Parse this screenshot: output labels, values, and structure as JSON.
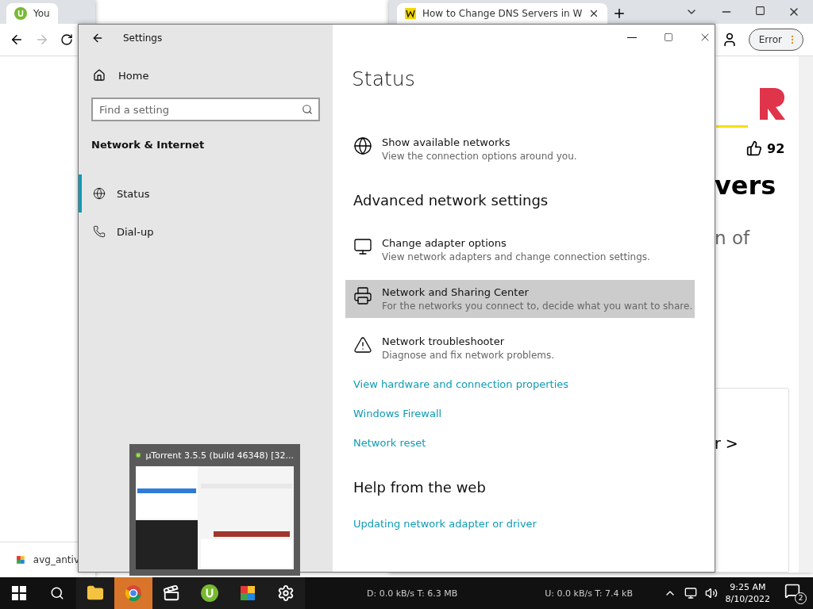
{
  "back_browser": {
    "tab_title": "You",
    "download": "avg_antiv"
  },
  "front_browser": {
    "tab_title": "How to Change DNS Servers in W",
    "profile_button": "Error",
    "likes": "92",
    "heading_fragment": "vers",
    "text_fragment": "n of",
    "link_fragment": "r >"
  },
  "settings": {
    "title": "Settings",
    "home": "Home",
    "search": {
      "placeholder": "Find a setting"
    },
    "section": "Network & Internet",
    "nav": [
      {
        "label": "Status",
        "selected": true
      },
      {
        "label": "Dial-up",
        "selected": false
      }
    ],
    "page_title": "Status",
    "content": [
      {
        "kind": "option",
        "title": "Show available networks",
        "description": "View the connection options around you.",
        "highlighted": false
      },
      {
        "kind": "heading",
        "title": "Advanced network settings"
      },
      {
        "kind": "option",
        "title": "Change adapter options",
        "description": "View network adapters and change connection settings.",
        "highlighted": false
      },
      {
        "kind": "option",
        "title": "Network and Sharing Center",
        "description": "For the networks you connect to, decide what you want to share.",
        "highlighted": true
      },
      {
        "kind": "option",
        "title": "Network troubleshooter",
        "description": "Diagnose and fix network problems.",
        "highlighted": false
      },
      {
        "kind": "link",
        "title": "View hardware and connection properties"
      },
      {
        "kind": "link",
        "title": "Windows Firewall"
      },
      {
        "kind": "link",
        "title": "Network reset"
      },
      {
        "kind": "heading",
        "title": "Help from the web"
      },
      {
        "kind": "link",
        "title": "Updating network adapter or driver"
      }
    ]
  },
  "thumbnail": {
    "title": "µTorrent 3.5.5  (build 46348) [32..."
  },
  "taskbar": {
    "apps": [
      {
        "selected": false
      },
      {
        "selected": true
      },
      {
        "selected": false
      },
      {
        "selected": false
      },
      {
        "selected": false
      },
      {
        "selected": false
      }
    ],
    "download_speed": "D: 0.0 kB/s T: 6.3 MB",
    "upload_speed": "U: 0.0 kB/s T: 7.4 kB",
    "time": "9:25 AM",
    "date": "8/10/2022",
    "notifications": "2"
  }
}
